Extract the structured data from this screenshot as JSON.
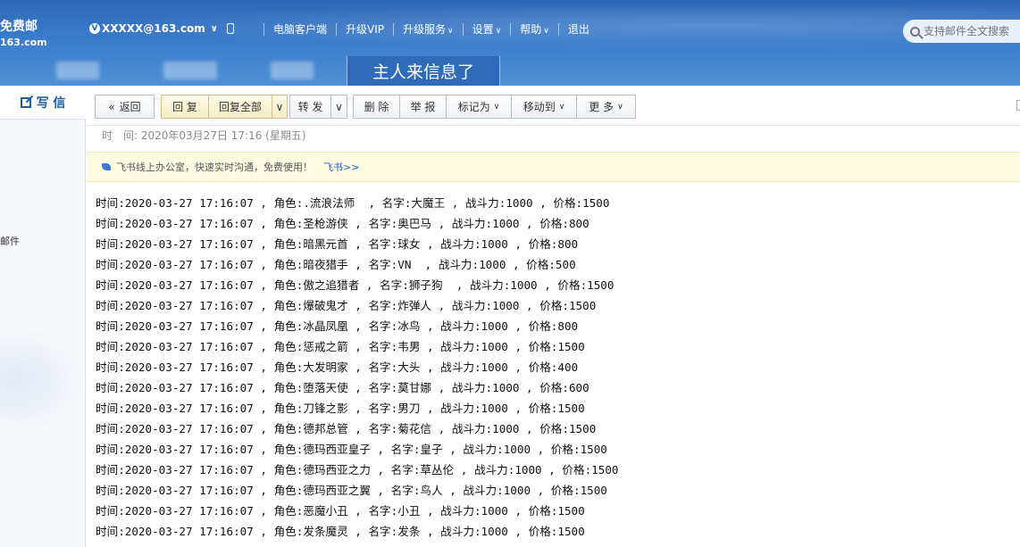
{
  "header": {
    "brand_line1": "免费邮",
    "brand_line2": "163.com",
    "account_badge": "V",
    "account": "XXXXX@163.com",
    "nav": [
      "电脑客户端",
      "升级VIP",
      "升级服务",
      "设置",
      "帮助",
      "退出"
    ],
    "search_placeholder": "支持邮件全文搜索",
    "active_tab": "主人来信息了"
  },
  "sidebar": {
    "write_label": "写 信",
    "item_label": "邮件"
  },
  "toolbar": {
    "back": "返回",
    "reply": "回 复",
    "reply_all": "回复全部",
    "forward": "转 发",
    "delete": "删 除",
    "report": "举 报",
    "mark_as": "标记为",
    "move_to": "移动到",
    "more": "更 多"
  },
  "mail": {
    "time_label": "时　间:",
    "time_value": "2020年03月27日 17:16 (星期五)",
    "ad_text": "飞书线上办公室，快速实时沟通，免费使用！",
    "ad_link": "飞书>>",
    "rows": [
      "时间:2020-03-27 17:16:07 , 角色:.流浪法师  , 名字:大魔王 , 战斗力:1000 , 价格:1500",
      "时间:2020-03-27 17:16:07 , 角色:圣枪游侠 , 名字:奥巴马 , 战斗力:1000 , 价格:800",
      "时间:2020-03-27 17:16:07 , 角色:暗黑元首 , 名字:球女 , 战斗力:1000 , 价格:800",
      "时间:2020-03-27 17:16:07 , 角色:暗夜猎手 , 名字:VN  , 战斗力:1000 , 价格:500",
      "时间:2020-03-27 17:16:07 , 角色:傲之追猎者 , 名字:狮子狗  , 战斗力:1000 , 价格:1500",
      "时间:2020-03-27 17:16:07 , 角色:爆破鬼才 , 名字:炸弹人 , 战斗力:1000 , 价格:1500",
      "时间:2020-03-27 17:16:07 , 角色:冰晶凤凰 , 名字:冰鸟 , 战斗力:1000 , 价格:800",
      "时间:2020-03-27 17:16:07 , 角色:惩戒之箭 , 名字:韦男 , 战斗力:1000 , 价格:1500",
      "时间:2020-03-27 17:16:07 , 角色:大发明家 , 名字:大头 , 战斗力:1000 , 价格:400",
      "时间:2020-03-27 17:16:07 , 角色:堕落天使 , 名字:莫甘娜 , 战斗力:1000 , 价格:600",
      "时间:2020-03-27 17:16:07 , 角色:刀锋之影 , 名字:男刀 , 战斗力:1000 , 价格:1500",
      "时间:2020-03-27 17:16:07 , 角色:德邦总管 , 名字:菊花信 , 战斗力:1000 , 价格:1500",
      "时间:2020-03-27 17:16:07 , 角色:德玛西亚皇子 , 名字:皇子 , 战斗力:1000 , 价格:1500",
      "时间:2020-03-27 17:16:07 , 角色:德玛西亚之力 , 名字:草丛伦 , 战斗力:1000 , 价格:1500",
      "时间:2020-03-27 17:16:07 , 角色:德玛西亚之翼 , 名字:鸟人 , 战斗力:1000 , 价格:1500",
      "时间:2020-03-27 17:16:07 , 角色:恶魔小丑 , 名字:小丑 , 战斗力:1000 , 价格:1500",
      "时间:2020-03-27 17:16:07 , 角色:发条魔灵 , 名字:发条 , 战斗力:1000 , 价格:1500"
    ]
  }
}
